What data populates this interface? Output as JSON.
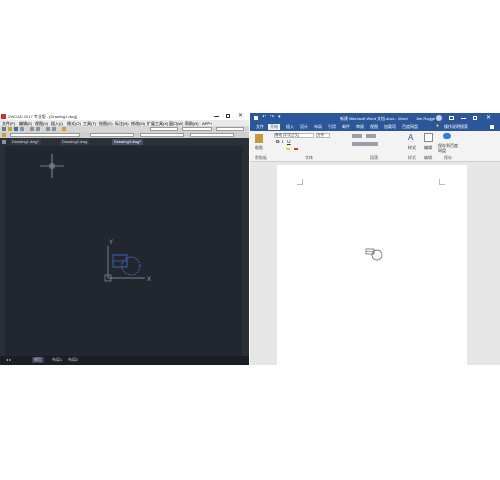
{
  "cad": {
    "title": "ZWCAD 2017 专业版 - [Drawing1.dwg]",
    "menu": [
      "文件(F)",
      "编辑(E)",
      "视图(V)",
      "插入(I)",
      "格式(O)",
      "工具(T)",
      "绘图(D)",
      "标注(N)",
      "修改(M)",
      "扩展工具(X)",
      "窗口(W)",
      "帮助(H)",
      "APP+"
    ],
    "tabs": [
      "Drawing1.dwg*",
      "Drawing2.dwg",
      "Drawing3.dwg*"
    ],
    "status_tabs": [
      "模型",
      "布局1",
      "布局2"
    ],
    "axis_x": "X",
    "axis_y": "Y",
    "colors": {
      "background": "#22262e",
      "accent": "#4a6fd1"
    }
  },
  "word": {
    "title": "新建 Microsoft Word 文档.docx - Word",
    "user": "Jim Rogge",
    "tabs": [
      "文件",
      "开始",
      "插入",
      "设计",
      "布局",
      "引用",
      "邮件",
      "审阅",
      "视图",
      "加载项",
      "百度网盘"
    ],
    "search": "操作说明搜索",
    "font_name": "等线 (中文正文)",
    "font_size": "五号",
    "groups": [
      "剪贴板",
      "字体",
      "段落",
      "样式",
      "编辑",
      "保存"
    ],
    "paste_label": "粘贴",
    "style_label": "样式",
    "edit_label": "编辑",
    "save_label": "保存到百度网盘",
    "colors": {
      "brand": "#2b579a"
    }
  }
}
